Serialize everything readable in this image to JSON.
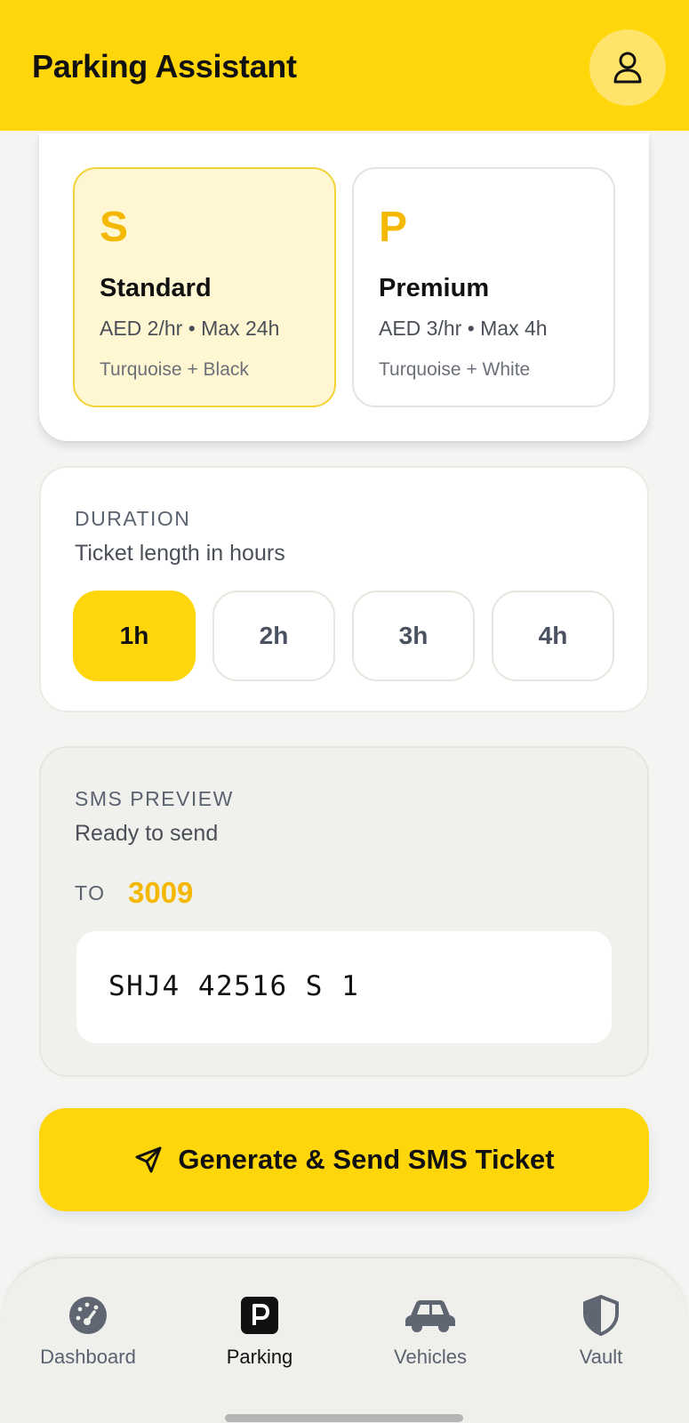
{
  "header": {
    "title": "Parking Assistant",
    "profile_icon": "user-icon"
  },
  "zones": [
    {
      "letter": "S",
      "name": "Standard",
      "rate": "AED 2/hr • Max 24h",
      "colors": "Turquoise + Black",
      "selected": true
    },
    {
      "letter": "P",
      "name": "Premium",
      "rate": "AED 3/hr • Max 4h",
      "colors": "Turquoise + White",
      "selected": false
    }
  ],
  "duration": {
    "label": "DURATION",
    "subtitle": "Ticket length in hours",
    "options": [
      "1h",
      "2h",
      "3h",
      "4h"
    ],
    "selected": "1h"
  },
  "sms": {
    "label": "SMS PREVIEW",
    "subtitle": "Ready to send",
    "to_label": "TO",
    "to_number": "3009",
    "message": "SHJ4 42516 S 1"
  },
  "send_button": {
    "label": "Generate & Send SMS Ticket",
    "icon": "send-icon"
  },
  "nav": {
    "items": [
      {
        "label": "Dashboard",
        "icon": "dashboard-icon",
        "active": false
      },
      {
        "label": "Parking",
        "icon": "parking-icon",
        "active": true
      },
      {
        "label": "Vehicles",
        "icon": "car-icon",
        "active": false
      },
      {
        "label": "Vault",
        "icon": "shield-icon",
        "active": false
      }
    ]
  },
  "colors": {
    "accent": "#ffd60a",
    "highlight": "#f5b800",
    "selected_bg": "#fff7d1"
  }
}
